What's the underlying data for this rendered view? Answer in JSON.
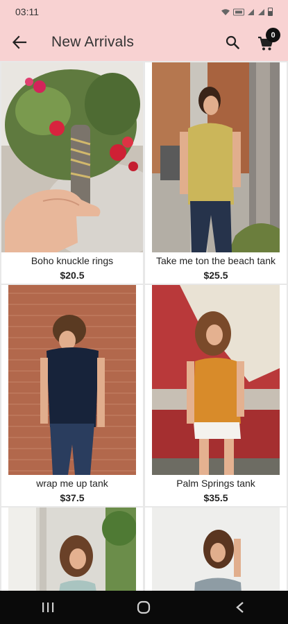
{
  "status_bar": {
    "time": "03:11",
    "icons": [
      "wifi-icon",
      "volte-icon",
      "signal-icon",
      "signal-icon",
      "battery-icon"
    ]
  },
  "app_bar": {
    "title": "New Arrivals",
    "back_icon": "arrow-left-icon",
    "search_icon": "search-icon",
    "cart_icon": "cart-icon",
    "cart_count": "0"
  },
  "products": [
    {
      "name": "Boho knuckle rings",
      "price": "$20.5"
    },
    {
      "name": "Take me ton the beach tank",
      "price": "$25.5"
    },
    {
      "name": "wrap me up tank",
      "price": "$37.5"
    },
    {
      "name": "Palm Springs tank",
      "price": "$35.5"
    },
    {
      "name": "",
      "price": ""
    },
    {
      "name": "",
      "price": ""
    }
  ],
  "nav_bar": {
    "recents_icon": "recents-icon",
    "home_icon": "home-icon",
    "back_icon": "back-triangle-icon"
  },
  "colors": {
    "app_bar_bg": "#f8d2d2",
    "nav_bar_bg": "#0a0a0a",
    "badge_bg": "#111111"
  }
}
